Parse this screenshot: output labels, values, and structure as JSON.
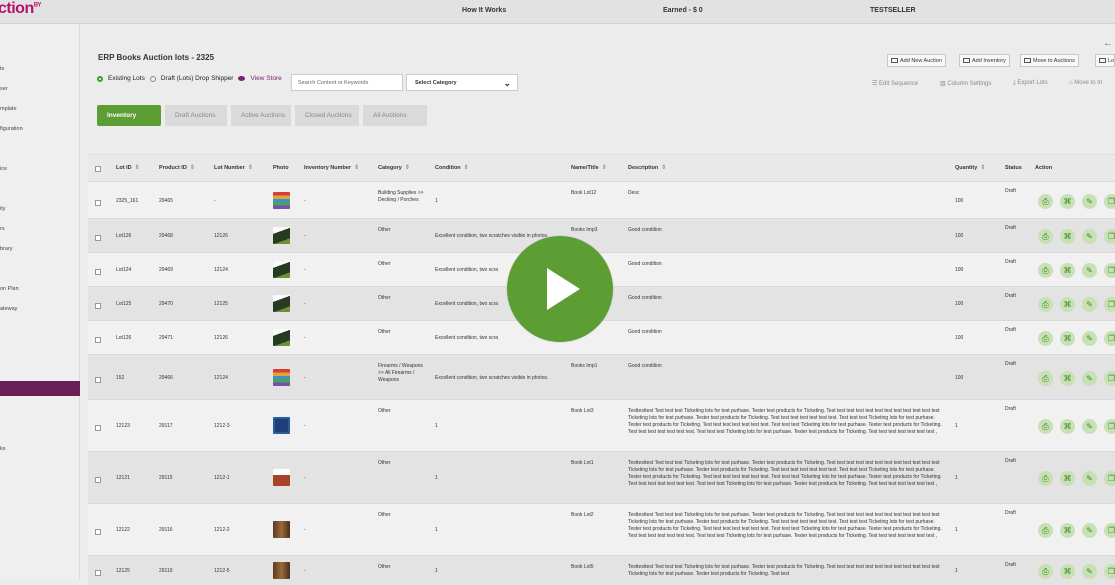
{
  "topbar": {
    "logo": "ction",
    "logo_suffix": "BY",
    "how_it_works": "How It Works",
    "earned": "Earned - $ 0",
    "user": "TESTSELLER"
  },
  "sidebar": {
    "items": [
      "ts",
      "ser",
      "mplate",
      "figuration",
      "ice",
      "ity",
      "rs",
      "brary",
      "on Plan",
      "ateway",
      "ks"
    ]
  },
  "page": {
    "title": "ERP Books Auction lots - 2325",
    "radio_existing": "Existing Lots",
    "radio_draft": "Draft (Lots) Drop Shipper",
    "view_store": "View Store",
    "search_placeholder": "Search Content or Keywords",
    "select_category": "Select Category"
  },
  "toolbar": {
    "add_auction": "Add New Auction",
    "add_inventory": "Add Inventory",
    "move_to_auctions": "Move to Auctions",
    "lot": "Lo",
    "edit_sequence": "Edit Sequence",
    "column_settings": "Column Settings",
    "export_lots": "Export Lots",
    "move_to_inv": "Move to In"
  },
  "tabs": [
    "Inventory",
    "Draft Auctions",
    "Active Auctions",
    "Closed Auctions",
    "All Auctions"
  ],
  "columns": {
    "lot_id": "Lot ID",
    "product_id": "Product ID",
    "lot_number": "Lot Number",
    "photo": "Photo",
    "inventory_number": "Inventory Number",
    "category": "Category",
    "condition": "Condition",
    "name": "Name/Title",
    "description": "Description",
    "quantity": "Quantity",
    "status": "Status",
    "action": "Action"
  },
  "rows": [
    {
      "lot_id": "2325_161",
      "product_id": "29465",
      "lot_number": "-",
      "photo": "books",
      "inv": "-",
      "category": "Building Supplies >> Decking / Porches",
      "condition": "1",
      "name": "Book Lot12",
      "description": "Desc",
      "quantity": "100",
      "status": "Draft"
    },
    {
      "lot_id": "Lot126",
      "product_id": "29468",
      "lot_number": "12126",
      "photo": "hills",
      "inv": "-",
      "category": "Other",
      "condition": "Excellent condition, two scratches visible in photos.",
      "name": "Books Imp3",
      "description": "Good condition",
      "quantity": "100",
      "status": "Draft"
    },
    {
      "lot_id": "Lot124",
      "product_id": "29469",
      "lot_number": "12124",
      "photo": "hills",
      "inv": "-",
      "category": "Other",
      "condition": "Excellent condition, two scra",
      "name": "",
      "description": "Good condition",
      "quantity": "100",
      "status": "Draft"
    },
    {
      "lot_id": "Lot125",
      "product_id": "29470",
      "lot_number": "12125",
      "photo": "hills",
      "inv": "-",
      "category": "Other",
      "condition": "Excellent condition, two scra",
      "name": "",
      "description": "Good condition",
      "quantity": "100",
      "status": "Draft"
    },
    {
      "lot_id": "Lot126",
      "product_id": "29471",
      "lot_number": "12126",
      "photo": "hills",
      "inv": "-",
      "category": "Other",
      "condition": "Excellent condition, two scra",
      "name": "p3",
      "description": "Good condition",
      "quantity": "100",
      "status": "Draft"
    },
    {
      "lot_id": "152",
      "product_id": "29466",
      "lot_number": "12124",
      "photo": "books",
      "inv": "-",
      "category": "Firearms / Weapons >> All Firearms / Weapons",
      "condition": "Excellent condition, two scratches visible in photos.",
      "name": "Books Imp1",
      "description": "Good condition",
      "quantity": "100",
      "status": "Draft"
    },
    {
      "lot_id": "12123",
      "product_id": "29117",
      "lot_number": "1212-3",
      "photo": "book",
      "inv": "-",
      "category": "Other",
      "condition": "1",
      "name": "Book Lot3",
      "description": "Testtesttest Test test test Ticketing lots for test purhase. Tester test products for Ticketing. Test test test test test test test test test test test test Ticketing lots for test purhase. Tester test products for Ticketing. Test test test test test test test. Test test test Ticketing lots for test purhase. Tester test products for Ticketing. Test test test test test test test. Test test test Ticketing lots for test purhase. Tester test products for Ticketing. Test test test test test test test. Test test test Ticketing lots for test purhase. Tester test products for Ticketing. Test test test test test test test ,",
      "quantity": "1",
      "status": "Draft"
    },
    {
      "lot_id": "12121",
      "product_id": "29115",
      "lot_number": "1212-1",
      "photo": "arch",
      "inv": "-",
      "category": "Other",
      "condition": "1",
      "name": "Book Lot1",
      "description": "Testtesttest Test test test Ticketing lots for test purhase. Tester test products for Ticketing. Test test test test test test test test test test test test Ticketing lots for test purhase. Tester test products for Ticketing. Test test test test test test test. Test test test Ticketing lots for test purhase. Tester test products for Ticketing. Test test test test test test test. Test test test Ticketing lots for test purhase. Tester test products for Ticketing. Test test test test test test test. Test test test Ticketing lots for test purhase. Tester test products for Ticketing. Test test test test test test test ,",
      "quantity": "1",
      "status": "Draft"
    },
    {
      "lot_id": "12122",
      "product_id": "29116",
      "lot_number": "1212-2",
      "photo": "room",
      "inv": "-",
      "category": "Other",
      "condition": "1",
      "name": "Book Lot2",
      "description": "Testtesttest Test test test Ticketing lots for test purhase. Tester test products for Ticketing. Test test test test test test test test test test test test Ticketing lots for test purhase. Tester test products for Ticketing. Test test test test test test test. Test test test Ticketing lots for test purhase. Tester test products for Ticketing. Test test test test test test test. Test test test Ticketing lots for test purhase. Tester test products for Ticketing. Test test test test test test test. Test test test Ticketing lots for test purhase. Tester test products for Ticketing. Test test test test test test test ,",
      "quantity": "1",
      "status": "Draft"
    },
    {
      "lot_id": "12125",
      "product_id": "29119",
      "lot_number": "1212-5",
      "photo": "room",
      "inv": "-",
      "category": "Other",
      "condition": "1",
      "name": "Book Lot5",
      "description": "Testtesttest Test test test Ticketing lots for test purhase. Tester test products for Ticketing. Test test test test test test test test test test test test Ticketing lots for test purhase. Tester test products for Ticketing. Test test",
      "quantity": "1",
      "status": "Draft"
    }
  ],
  "colors": {
    "accent": "#5d9e34",
    "brand": "#b5126e",
    "sidebar_active": "#6a1e57"
  }
}
